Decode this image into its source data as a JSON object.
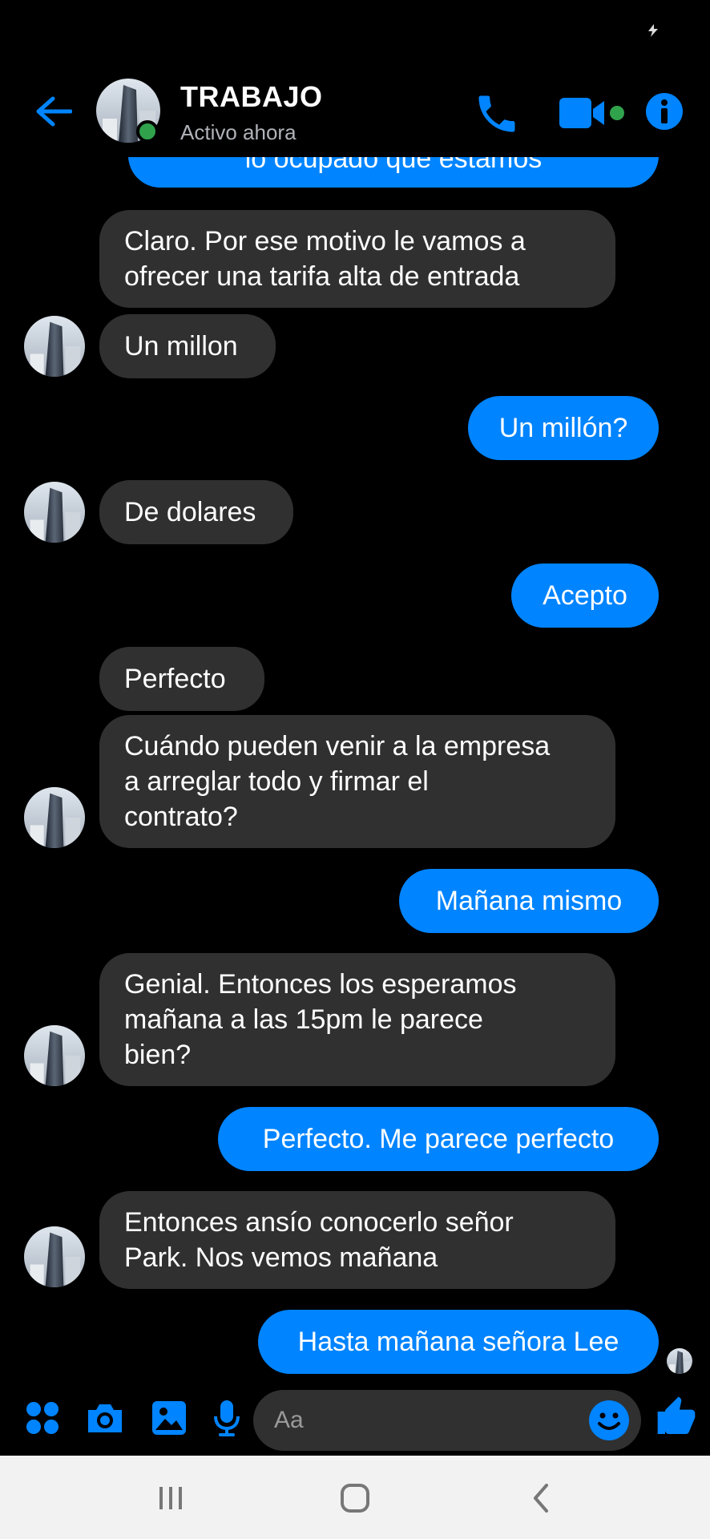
{
  "header": {
    "title": "TRABAJO",
    "status": "Activo ahora"
  },
  "messages": [
    {
      "dir": "out",
      "text": "lo ocupado que estamos"
    },
    {
      "dir": "in",
      "text": "Claro. Por ese motivo le vamos a\nofrecer una tarifa alta de entrada"
    },
    {
      "dir": "in",
      "text": "Un millon"
    },
    {
      "dir": "out",
      "text": "Un millón?"
    },
    {
      "dir": "in",
      "text": "De dolares"
    },
    {
      "dir": "out",
      "text": "Acepto"
    },
    {
      "dir": "in",
      "text": "Perfecto"
    },
    {
      "dir": "in",
      "text": "Cuándo pueden venir a la empresa\na arreglar todo y firmar el\ncontrato?"
    },
    {
      "dir": "out",
      "text": "Mañana mismo"
    },
    {
      "dir": "in",
      "text": "Genial. Entonces los esperamos\nmañana a las 15pm le parece\nbien?"
    },
    {
      "dir": "out",
      "text": "Perfecto. Me parece perfecto"
    },
    {
      "dir": "in",
      "text": "Entonces ansío conocerlo señor\nPark. Nos vemos mañana"
    },
    {
      "dir": "out",
      "text": "Hasta mañana señora Lee"
    }
  ],
  "composer": {
    "placeholder": "Aa"
  },
  "colors": {
    "accent": "#0084ff",
    "incoming_bubble": "#303030",
    "background": "#000000",
    "online": "#31a24c"
  },
  "icons": [
    "back-arrow-icon",
    "phone-icon",
    "video-camera-icon",
    "info-icon",
    "apps-icon",
    "camera-icon",
    "gallery-icon",
    "microphone-icon",
    "emoji-icon",
    "thumbs-up-icon",
    "recents-icon",
    "home-icon",
    "back-icon"
  ]
}
